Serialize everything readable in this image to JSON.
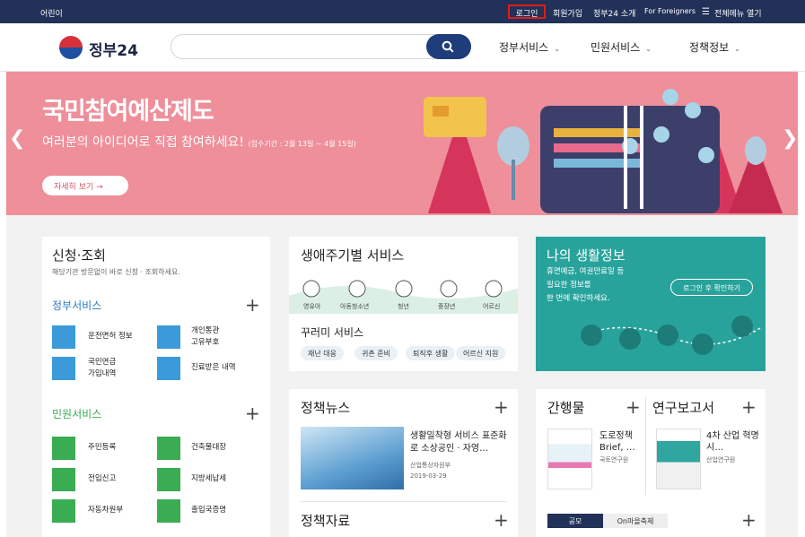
{
  "topbar": {
    "kids": "어린이",
    "login": "로그인",
    "signup": "회원가입",
    "intro": "정부24 소개",
    "foreigners": "For Foreigners",
    "menu": "전체메뉴 열기"
  },
  "header": {
    "brand": "정부24",
    "nav": [
      "정부서비스",
      "민원서비스",
      "정책정보"
    ]
  },
  "banner": {
    "title": "국민참여예산제도",
    "subtitle": "여러분의 아이디어로 직접 참여하세요!",
    "period": "(접수기간 : 2월 13일 ~ 4월 15일)",
    "button": "자세히 보기  →"
  },
  "apply": {
    "title": "신청·조회",
    "desc": "해당기관 방문없이 바로 신청 · 조회하세요.",
    "gov_title": "정부서비스",
    "gov": [
      {
        "label": "운전면허 정보"
      },
      {
        "label": "개인통관\n고유부호"
      },
      {
        "label": "국민연금\n가입내역"
      },
      {
        "label": "진료받은 내역"
      }
    ],
    "civil_title": "민원서비스",
    "civil": [
      {
        "label": "주민등록"
      },
      {
        "label": "건축물대장"
      },
      {
        "label": "전입신고"
      },
      {
        "label": "지방세납세"
      },
      {
        "label": "자동차원부"
      },
      {
        "label": "출입국증명"
      }
    ]
  },
  "lifecycle": {
    "title": "생애주기별 서비스",
    "stages": [
      "영유아",
      "아동청소년",
      "청년",
      "중장년",
      "어르신"
    ],
    "bundle_title": "꾸러미 서비스",
    "bundles": [
      "재난 대응",
      "귀촌 준비",
      "퇴직후 생활",
      "어르신 지원"
    ]
  },
  "mylife": {
    "title": "나의 생활정보",
    "desc": "휴면예금, 여권만료일 등\n필요한 정보를\n한 번에 확인하세요.",
    "button": "로그인 후 확인하기"
  },
  "news": {
    "title": "정책뉴스",
    "headline": "생활밀착형 서비스 표준화로 소상공인 · 자영…",
    "source": "산업통상자원부",
    "date": "2019-03-29",
    "data_title": "정책자료"
  },
  "pubs": {
    "title": "간행물",
    "item": "도로정책 Brief, …",
    "source": "국토연구원"
  },
  "reports": {
    "title": "연구보고서",
    "item": "4차 산업 혁명 시…",
    "source": "산업연구원"
  },
  "bottom_tabs": [
    "공모",
    "On마을축제"
  ],
  "colors": {
    "navy": "#223157",
    "banner": "#ee8f9a",
    "teal": "#28a39c",
    "gov_icon": "#3b9ad9",
    "civil_icon": "#3aac52"
  }
}
